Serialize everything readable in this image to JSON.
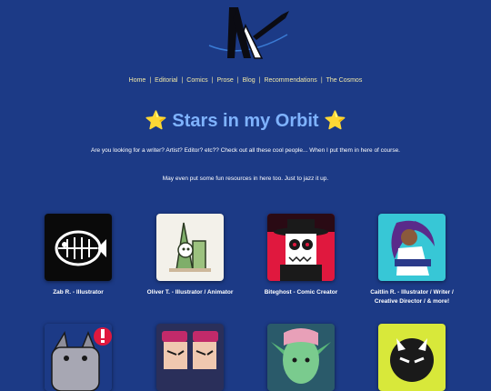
{
  "nav": {
    "items": [
      "Home",
      "Editorial",
      "Comics",
      "Prose",
      "Blog",
      "Recommendations",
      "The Cosmos"
    ]
  },
  "page": {
    "title": "Stars in my Orbit",
    "star_glyph": "⭐",
    "intro": "Are you looking for a writer? Artist? Editor? etc?? Check out all these cool people... When I put them in here of course.",
    "intro2": "May even put some fun resources in here too. Just to jazz it up."
  },
  "cards": [
    {
      "label": "Zab R. - Illustrator"
    },
    {
      "label": "Oliver T. - Illustrator / Animator"
    },
    {
      "label": "Biteghost - Comic Creator"
    },
    {
      "label": "Caitlin R. - Illustrator / Writer / Creative Director / & more!"
    }
  ],
  "colors": {
    "background": "#1c3a86",
    "nav_text": "#f2e9a8",
    "title": "#7fb3ff",
    "star": "#f5c518"
  }
}
